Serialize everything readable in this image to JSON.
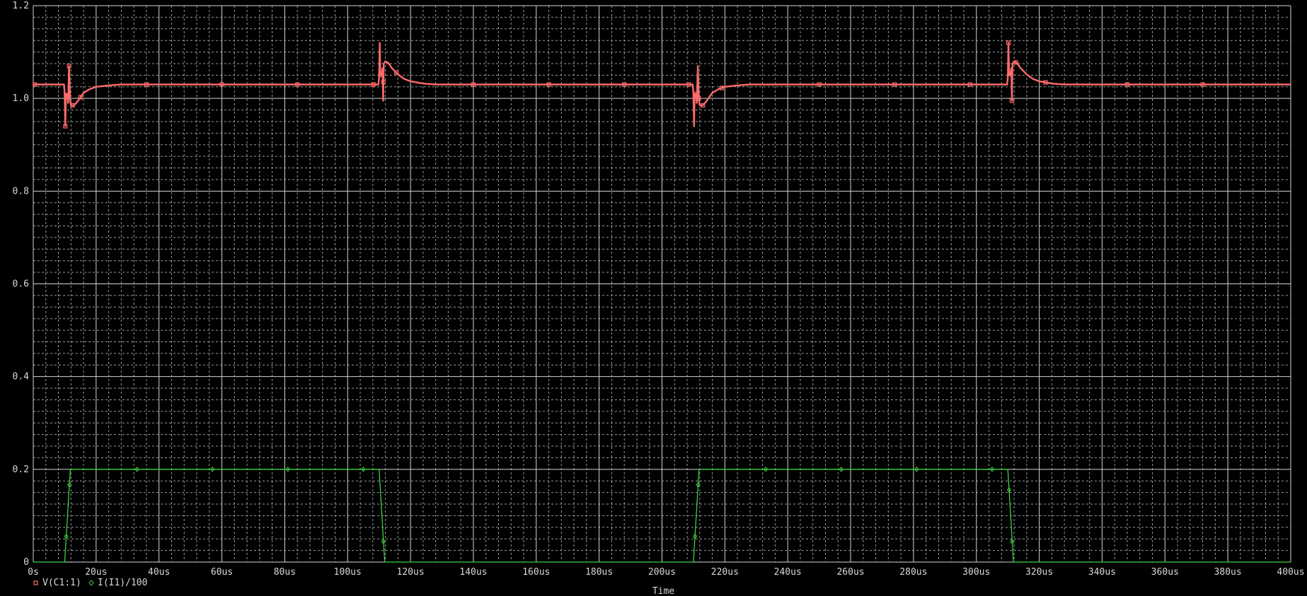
{
  "chart_data": {
    "type": "line",
    "title": "",
    "xlabel": "Time",
    "ylabel": "",
    "xlim": [
      0,
      400
    ],
    "ylim": [
      0,
      1.2
    ],
    "x_unit": "us",
    "grid": true,
    "x_ticks": [
      0,
      20,
      40,
      60,
      80,
      100,
      120,
      140,
      160,
      180,
      200,
      220,
      240,
      260,
      280,
      300,
      320,
      340,
      360,
      380,
      400
    ],
    "x_tick_labels": [
      "0s",
      "20us",
      "40us",
      "60us",
      "80us",
      "100us",
      "120us",
      "140us",
      "160us",
      "180us",
      "200us",
      "220us",
      "240us",
      "260us",
      "280us",
      "300us",
      "320us",
      "340us",
      "360us",
      "380us",
      "400us"
    ],
    "y_ticks": [
      0,
      0.2,
      0.4,
      0.6,
      0.8,
      1.0,
      1.2
    ],
    "y_tick_labels": [
      "0",
      "0.2",
      "0.4",
      "0.6",
      "0.8",
      "1.0",
      "1.2"
    ],
    "legend_position": "bottom-left",
    "series": [
      {
        "name": "V(C1:1)",
        "color": "#ff6b6b",
        "marker": "square",
        "points": [
          [
            0,
            1.03
          ],
          [
            9.8,
            1.03
          ],
          [
            10.0,
            1.01
          ],
          [
            10.2,
            0.94
          ],
          [
            10.4,
            1.01
          ],
          [
            10.8,
            1.01
          ],
          [
            11.1,
            0.99
          ],
          [
            11.4,
            1.07
          ],
          [
            11.7,
            1.0
          ],
          [
            12.0,
            0.985
          ],
          [
            13.0,
            0.985
          ],
          [
            14.0,
            0.993
          ],
          [
            16.0,
            1.012
          ],
          [
            18.0,
            1.02
          ],
          [
            20.0,
            1.025
          ],
          [
            24.0,
            1.028
          ],
          [
            28.0,
            1.03
          ],
          [
            109.8,
            1.03
          ],
          [
            110.0,
            1.045
          ],
          [
            110.2,
            1.12
          ],
          [
            110.4,
            1.05
          ],
          [
            110.8,
            1.05
          ],
          [
            111.1,
            1.065
          ],
          [
            111.3,
            0.995
          ],
          [
            111.5,
            1.075
          ],
          [
            112.0,
            1.08
          ],
          [
            113.0,
            1.076
          ],
          [
            114.0,
            1.066
          ],
          [
            116.0,
            1.052
          ],
          [
            118.0,
            1.042
          ],
          [
            120.0,
            1.037
          ],
          [
            124.0,
            1.032
          ],
          [
            128.0,
            1.03
          ],
          [
            209.8,
            1.03
          ],
          [
            210.0,
            1.01
          ],
          [
            210.2,
            0.94
          ],
          [
            210.4,
            1.01
          ],
          [
            210.8,
            1.01
          ],
          [
            211.1,
            0.99
          ],
          [
            211.4,
            1.07
          ],
          [
            211.7,
            1.0
          ],
          [
            212.0,
            0.985
          ],
          [
            213.0,
            0.985
          ],
          [
            214.0,
            0.993
          ],
          [
            216.0,
            1.012
          ],
          [
            218.0,
            1.02
          ],
          [
            220.0,
            1.025
          ],
          [
            224.0,
            1.028
          ],
          [
            228.0,
            1.03
          ],
          [
            309.8,
            1.03
          ],
          [
            310.0,
            1.045
          ],
          [
            310.2,
            1.12
          ],
          [
            310.4,
            1.05
          ],
          [
            310.8,
            1.05
          ],
          [
            311.1,
            1.065
          ],
          [
            311.3,
            0.995
          ],
          [
            311.5,
            1.075
          ],
          [
            312.0,
            1.08
          ],
          [
            313.0,
            1.076
          ],
          [
            314.0,
            1.066
          ],
          [
            316.0,
            1.052
          ],
          [
            318.0,
            1.042
          ],
          [
            320.0,
            1.037
          ],
          [
            324.0,
            1.032
          ],
          [
            328.0,
            1.03
          ],
          [
            400,
            1.03
          ]
        ],
        "marker_x": [
          0.5,
          10.2,
          11.4,
          12.5,
          15,
          36,
          60,
          84,
          108.2,
          110.4,
          111.4,
          115.5,
          140,
          164,
          188,
          208.5,
          210.6,
          211.7,
          213,
          219,
          250,
          274,
          298,
          310.2,
          311.3,
          312.6,
          322,
          348,
          372
        ]
      },
      {
        "name": "I(I1)/100",
        "color": "#3ecf3e",
        "marker": "diamond",
        "points": [
          [
            0,
            0
          ],
          [
            10.0,
            0
          ],
          [
            11.8,
            0.2
          ],
          [
            110.0,
            0.2
          ],
          [
            111.8,
            0
          ],
          [
            210.0,
            0
          ],
          [
            211.8,
            0.2
          ],
          [
            310.0,
            0.2
          ],
          [
            311.8,
            0
          ],
          [
            400,
            0
          ]
        ],
        "marker_x": [
          10.5,
          11.5,
          33,
          57,
          81,
          105,
          111.4,
          210.5,
          211.5,
          233,
          257,
          281,
          305,
          310.4,
          311.4
        ]
      }
    ]
  }
}
